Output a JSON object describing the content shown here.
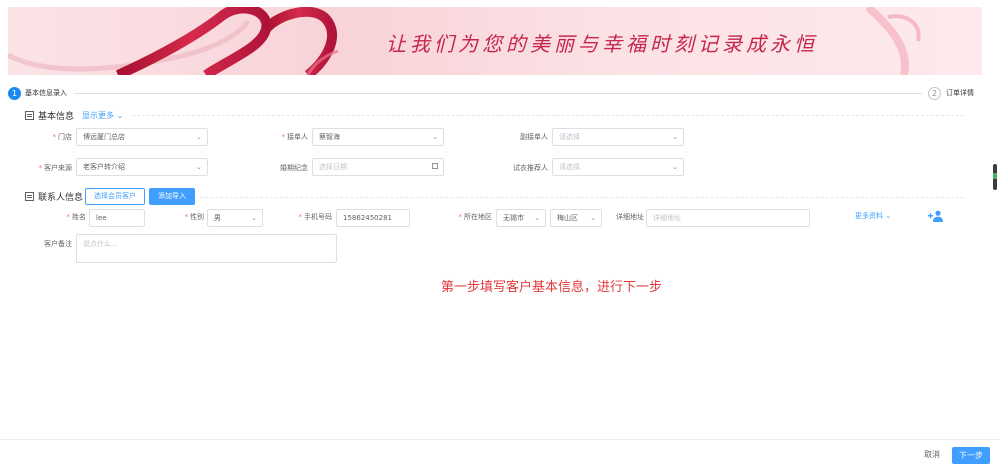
{
  "banner": {
    "slogan": "让我们为您的美丽与幸福时刻记录成永恒",
    "colors": {
      "ribbon": "#c6264b",
      "slogan": "#c6264b"
    }
  },
  "steps": [
    {
      "number": "1",
      "label": "基本信息录入",
      "state": "active"
    },
    {
      "number": "2",
      "label": "订单详情",
      "state": "inactive"
    }
  ],
  "basic_info": {
    "title": "基本信息",
    "toggle": "显示更多",
    "fields": {
      "store": {
        "label": "门店",
        "required": true,
        "value": "博远厦门总店"
      },
      "handler": {
        "label": "接单人",
        "required": true,
        "value": "蔡智海"
      },
      "assistant": {
        "label": "副接单人",
        "required": false,
        "placeholder": "请选择"
      },
      "source": {
        "label": "客户来源",
        "required": true,
        "value": "老客户转介绍"
      },
      "wedding": {
        "label": "婚期纪念",
        "required": false,
        "placeholder": "选择日期"
      },
      "dress": {
        "label": "试衣推荐人",
        "required": false,
        "placeholder": "请选择"
      }
    }
  },
  "contact": {
    "title": "联系人信息",
    "select_member_button": "选择会员客户",
    "add_button": "添加导入",
    "fields": {
      "name": {
        "label": "姓名",
        "required": true,
        "value": "lee"
      },
      "gender": {
        "label": "性别",
        "required": true,
        "value": "男"
      },
      "phone": {
        "label": "手机号码",
        "required": true,
        "value": "15862450281"
      },
      "region": {
        "label": "所在地区",
        "required": true,
        "city": "无锡市",
        "district": "梅山区"
      },
      "address": {
        "label": "详细地址",
        "required": false,
        "placeholder": "详细地址"
      },
      "more": {
        "label": "更多资料"
      },
      "remark": {
        "label": "客户备注",
        "placeholder": "说点什么..."
      }
    }
  },
  "hint": "第一步填写客户基本信息，进行下一步",
  "footer": {
    "cancel": "取消",
    "next": "下一步"
  },
  "icons": {
    "dropdown": "chevron-down-icon",
    "calendar": "calendar-icon",
    "add_user": "add-user-icon",
    "section": "form-icon"
  },
  "colors": {
    "primary": "#409eff",
    "required": "#f56c6c",
    "hint": "#e4393c"
  }
}
